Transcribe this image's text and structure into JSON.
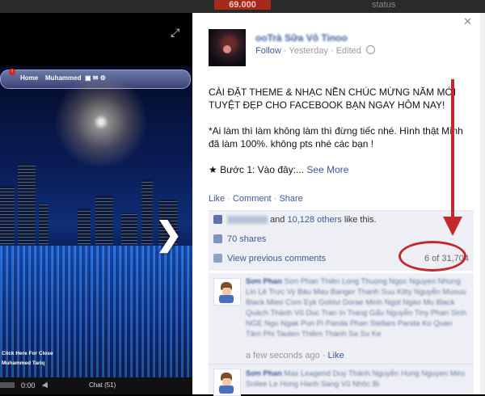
{
  "background": {
    "price_badge": "69.000",
    "status_text": "status"
  },
  "photo": {
    "navbar": {
      "home": "Home",
      "profile": "Muhammed"
    },
    "captions": {
      "click_close": "Click Here For Close",
      "author": "Muhammed Tariq"
    },
    "player": {
      "time": "0:00",
      "chat": "Chat (51)"
    },
    "next_arrow": "❯",
    "expand_icon": "⤢"
  },
  "post": {
    "page_name": "ooTrà Sữa Vô Tinoo",
    "follow": "Follow",
    "time": "Yesterday",
    "edited": "Edited",
    "headline": "CÀI ĐẶT THEME & NHẠC NỀN CHÚC MỪNG NĂM MỚI TUYỆT ĐẸP CHO FACEBOOK BẠN NGAY HÔM NAY!",
    "body": "*Ai làm thì làm không làm thì đừng tiếc nhé. Hình thật Mình đã làm 100%. không pts nhé các bạn !",
    "step": "★ Bước 1: Vào đây:...",
    "see_more": "See More",
    "actions": {
      "like": "Like",
      "comment": "Comment",
      "share": "Share"
    }
  },
  "engagement": {
    "likes_prefix": "and",
    "likes_count": "10,128 others",
    "likes_suffix": "like this.",
    "shares": "70 shares",
    "view_previous": "View previous comments",
    "comment_count": "6 of 31,704"
  },
  "comments": [
    {
      "author": "Sơn Phan",
      "text": "Sơn Phan Thiên Long Thuọng Ngọc Nguyen Nhung Lin Lê Trưc Vy Báu Mau Banger Thanh Suu Kitty Nguyễn Muouu Black Mieo Com Eyk Goldvi Dorae Minh Ngọt Ngào Mu Black Quách Thành Vũ Duc Tran In Trang Gấu Nguyễn Tiny Phan Sinh NGE Ngu Ngak Pun Pi Panda Phan Stellars Panda Ko Quan Tâm Phi Tauten Thiềm Thành Sa Su Ke",
      "time": "a few seconds ago",
      "like": "Like"
    },
    {
      "author": "Sơn Phan",
      "text": "Max Leagend Duy Thành Nguyễn Hung Nguyen Mèo Snilee Le Hong Hanh Sang Vũ Nhôc Bi"
    }
  ],
  "colors": {
    "link": "#3b5998",
    "highlight": "#c1292e",
    "panel": "#edeff4"
  }
}
